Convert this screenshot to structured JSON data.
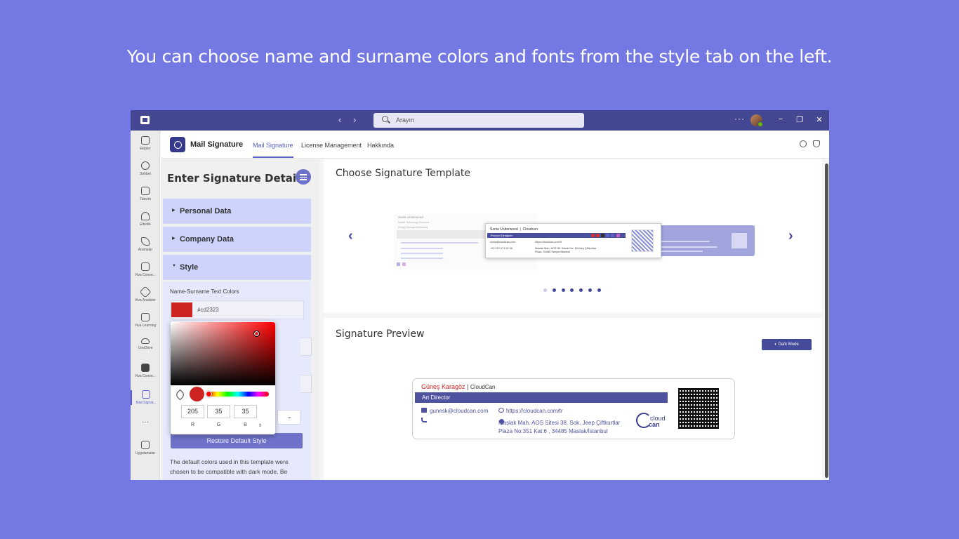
{
  "caption": "You can choose name and surname colors and fonts from the style tab on the left.",
  "titlebar": {
    "search_placeholder": "Arayın",
    "more": "···",
    "minimize": "−",
    "restore": "❐",
    "close": "✕",
    "back": "‹",
    "forward": "›"
  },
  "rail": {
    "items": [
      {
        "label": "Ekipler",
        "icon": "teams-icon"
      },
      {
        "label": "Sohbet",
        "icon": "chat-icon"
      },
      {
        "label": "Takvim",
        "icon": "calendar-icon"
      },
      {
        "label": "Etkinlik",
        "icon": "bell-icon"
      },
      {
        "label": "Aramalar",
        "icon": "phone-icon"
      },
      {
        "label": "Viva Conne...",
        "icon": "viva-connections-icon"
      },
      {
        "label": "Viva Analizler",
        "icon": "viva-insights-icon"
      },
      {
        "label": "Viva Learning",
        "icon": "viva-learning-icon"
      },
      {
        "label": "OneDrive",
        "icon": "cloud-icon"
      },
      {
        "label": "Viva Conne...",
        "icon": "viva-connections-icon"
      },
      {
        "label": "Mail Signat...",
        "icon": "mail-signature-icon"
      }
    ],
    "more": "···",
    "apps_label": "Uygulamalar"
  },
  "app": {
    "title": "Mail Signature",
    "tabs": [
      "Mail Signature",
      "License Management",
      "Hakkında"
    ],
    "active_tab": "Mail Signature"
  },
  "left": {
    "title": "Enter Signature Details",
    "sections": [
      "Personal Data",
      "Company Data",
      "Style"
    ],
    "name_color_label": "Name-Surname Text Colors",
    "name_color_hex": "#cd2323",
    "restore_button": "Restore Default Style",
    "note": "The default colors used in this template were chosen to be compatible with dark mode. Be"
  },
  "picker": {
    "r": "205",
    "g": "35",
    "b": "35",
    "r_label": "R",
    "g_label": "G",
    "b_label": "B",
    "toggle": "⇕",
    "color": "#cd2323"
  },
  "templates": {
    "title": "Choose Signature Template",
    "prev": "‹",
    "next": "›",
    "featured": {
      "name": "Sonia Underwood",
      "company": "Cloudcan",
      "role": "Product Designer",
      "email": "sonia@cloudcan.com",
      "web": "https://cloudcan.com/tr",
      "phone": "+90 212 971 00 36",
      "address": "Maslak Mah. AOS 38. Sokak No: 16/Jeep Çiftkurtlar Plaza, 34485 Sarıyer/İstanbul"
    },
    "left_preview": {
      "name": "Sonia Underwood",
      "line1": "Mobile Technology Solutions",
      "line2": "Energy Manager/Marketing"
    },
    "dot_count": 7,
    "active_dot": 0
  },
  "preview": {
    "title": "Signature Preview",
    "dark_mode_button": "Dark Mode",
    "name": "Güneş Karagöz",
    "separator": "|",
    "company": "CloudCan",
    "role": "Art Director",
    "email": "gunesk@cloudcan.com",
    "web": "https://cloudcan.com/tr",
    "address_line1": "Maslak Mah. AOS Sitesi 38. Sok. Jeep Çiftkurtlar",
    "address_line2": "Plaza No:351 Kat:6 , 34485 Maslak/İstanbul",
    "logo_text_top": "cloud",
    "logo_text_bottom": "can",
    "name_color": "#cd2323",
    "accent_color": "#4e529f"
  }
}
